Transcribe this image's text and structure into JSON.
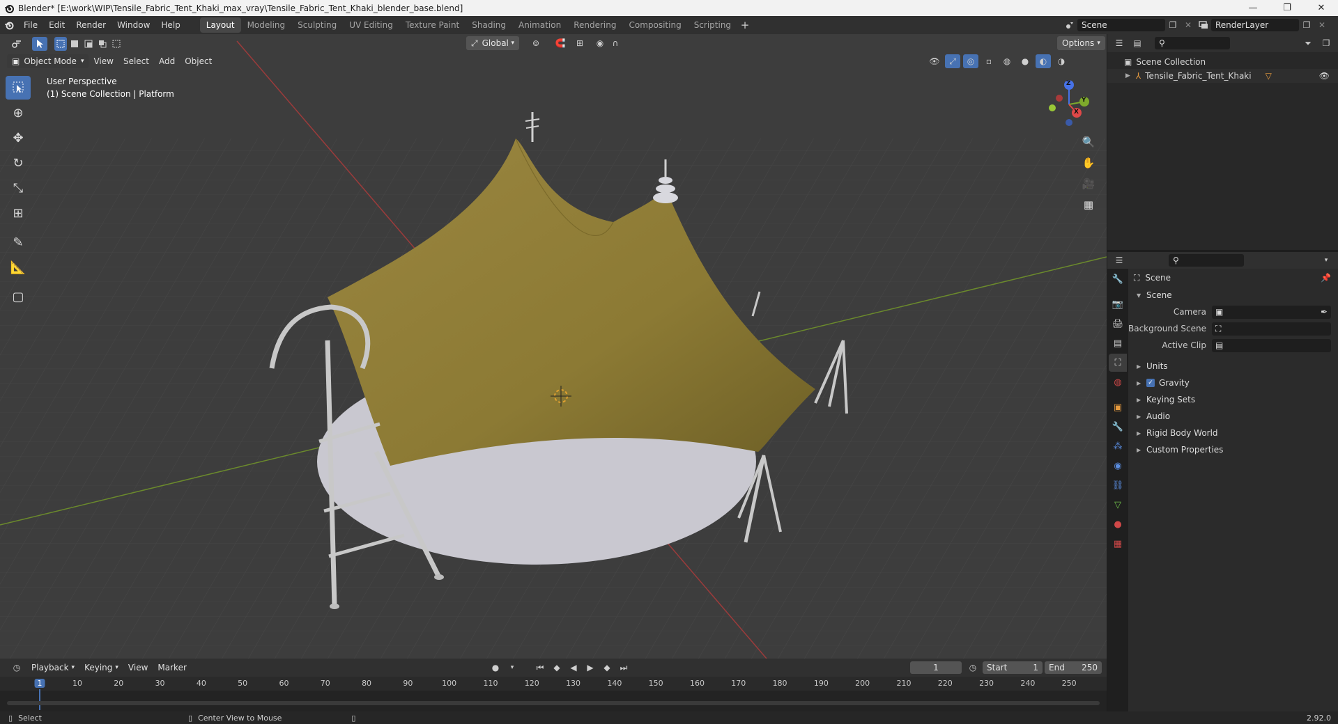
{
  "titlebar": {
    "title": "Blender* [E:\\work\\WIP\\Tensile_Fabric_Tent_Khaki_max_vray\\Tensile_Fabric_Tent_Khaki_blender_base.blend]",
    "min": "—",
    "max": "❐",
    "close": "✕"
  },
  "menu": [
    "File",
    "Edit",
    "Render",
    "Window",
    "Help"
  ],
  "workspaces": [
    "Layout",
    "Modeling",
    "Sculpting",
    "UV Editing",
    "Texture Paint",
    "Shading",
    "Animation",
    "Rendering",
    "Compositing",
    "Scripting"
  ],
  "workspace_add": "+",
  "scene": {
    "name": "Scene",
    "render_layer": "RenderLayer"
  },
  "viewport": {
    "mode": "Object Mode",
    "menus": [
      "View",
      "Select",
      "Add",
      "Object"
    ],
    "orientation": "Global",
    "options_label": "Options",
    "info_line1": "User Perspective",
    "info_line2": "(1) Scene Collection | Platform",
    "gizmo": {
      "x": "X",
      "y": "Y",
      "z": "Z"
    }
  },
  "outliner": {
    "root": "Scene Collection",
    "items": [
      {
        "label": "Tensile_Fabric_Tent_Khaki"
      }
    ]
  },
  "properties": {
    "context": "Scene",
    "panel_title": "Scene",
    "fields": [
      {
        "label": "Camera",
        "value": ""
      },
      {
        "label": "Background Scene",
        "value": ""
      },
      {
        "label": "Active Clip",
        "value": ""
      }
    ],
    "subpanels": [
      "Units",
      "Gravity",
      "Keying Sets",
      "Audio",
      "Rigid Body World",
      "Custom Properties"
    ],
    "gravity_checked": true
  },
  "timeline": {
    "menus": [
      "Playback",
      "Keying",
      "View",
      "Marker"
    ],
    "current_frame": "1",
    "start_label": "Start",
    "start": "1",
    "end_label": "End",
    "end": "250",
    "ruler": [
      "1",
      "10",
      "20",
      "30",
      "40",
      "50",
      "60",
      "70",
      "80",
      "90",
      "100",
      "110",
      "120",
      "130",
      "140",
      "150",
      "160",
      "170",
      "180",
      "190",
      "200",
      "210",
      "220",
      "230",
      "240",
      "250"
    ]
  },
  "status": {
    "left": "Select",
    "middle": "Center View to Mouse",
    "version": "2.92.0"
  },
  "colors": {
    "accent": "#4772b3",
    "tent": "#8c7a34",
    "floor": "#c9c8d0",
    "axis_red": "#a33a3a",
    "axis_green": "#6c8f2a"
  }
}
